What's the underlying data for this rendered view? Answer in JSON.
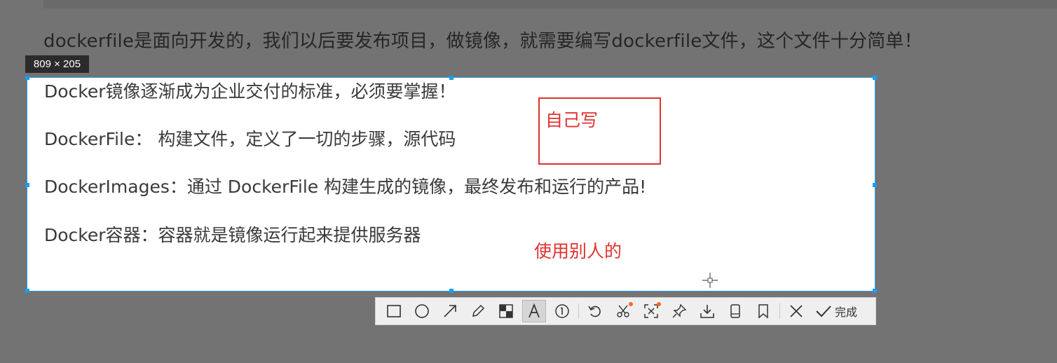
{
  "background": {
    "heading_text": "dockerfile是面向开发的，我们以后要发布项目，做镜像，就需要编写dockerfile文件，这个文件十分简单！"
  },
  "capture": {
    "size_label": "809 × 205",
    "lines": [
      "Docker镜像逐渐成为企业交付的标准，必须要掌握！",
      "DockerFile： 构建文件，定义了一切的步骤，源代码",
      "DockerImages：通过 DockerFile 构建生成的镜像，最终发布和运行的产品!",
      "Docker容器：容器就是镜像运行起来提供服务器"
    ],
    "annotation_box_text": "自己写",
    "annotation_free_text": "使用别人的",
    "accent_color": "#1a9cf0",
    "annotation_color": "#e0322f"
  },
  "toolbar": {
    "tools": [
      {
        "icon": "rectangle-icon",
        "active": false
      },
      {
        "icon": "ellipse-icon",
        "active": false
      },
      {
        "icon": "arrow-icon",
        "active": false
      },
      {
        "icon": "pencil-icon",
        "active": false
      },
      {
        "icon": "mosaic-icon",
        "active": false
      },
      {
        "icon": "text-icon",
        "active": true
      },
      {
        "icon": "number-marker-icon",
        "active": false
      },
      {
        "icon": "undo-icon",
        "active": false
      },
      {
        "icon": "cut-icon",
        "active": false
      },
      {
        "icon": "ocr-icon",
        "active": false
      },
      {
        "icon": "pin-icon",
        "active": false
      },
      {
        "icon": "download-icon",
        "active": false
      },
      {
        "icon": "phone-icon",
        "active": false
      },
      {
        "icon": "bookmark-icon",
        "active": false
      },
      {
        "icon": "close-icon",
        "active": false
      }
    ],
    "finish_label": "完成"
  }
}
